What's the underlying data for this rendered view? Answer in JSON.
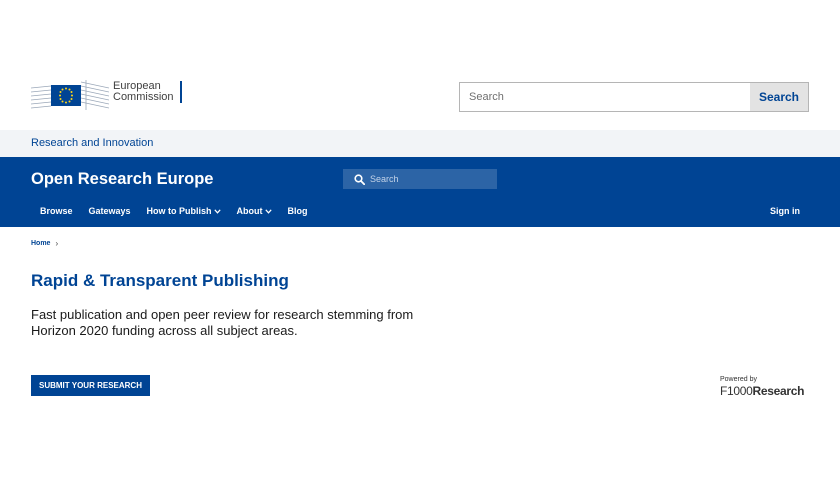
{
  "header": {
    "logo_line1": "European",
    "logo_line2": "Commission",
    "search_placeholder": "Search",
    "search_button": "Search"
  },
  "site_bar": {
    "label": "Research and Innovation"
  },
  "ore": {
    "brand": "Open Research Europe",
    "search_placeholder": "Search",
    "nav": [
      {
        "label": "Browse",
        "has_dropdown": false
      },
      {
        "label": "Gateways",
        "has_dropdown": false
      },
      {
        "label": "How to Publish",
        "has_dropdown": true
      },
      {
        "label": "About",
        "has_dropdown": true
      },
      {
        "label": "Blog",
        "has_dropdown": false
      }
    ],
    "signin": "Sign in"
  },
  "breadcrumb": {
    "home": "Home"
  },
  "main": {
    "title": "Rapid & Transparent Publishing",
    "description": "Fast publication and open peer review for research stemming from Horizon 2020 funding across all subject areas.",
    "submit_button": "SUBMIT YOUR RESEARCH"
  },
  "powered": {
    "label": "Powered by",
    "brand_part1": "F1000",
    "brand_part2": "Research"
  },
  "colors": {
    "primary": "#004494",
    "site_bar_bg": "#f2f4f7",
    "eu_star": "#ffd617"
  }
}
